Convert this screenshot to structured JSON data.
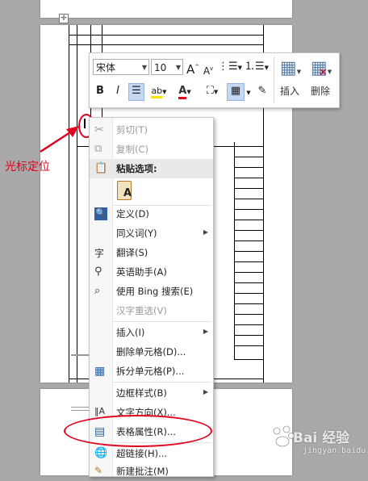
{
  "annotation": {
    "cursor_label": "光标定位"
  },
  "toolbar": {
    "font_name": "宋体",
    "font_size": "10",
    "insert_label": "插入",
    "delete_label": "删除",
    "bold": "B",
    "italic": "I",
    "grow_font": "A",
    "shrink_font": "A",
    "font_color": "A",
    "highlight": "ab"
  },
  "context_menu": {
    "items": [
      {
        "label": "剪切(T)",
        "disabled": true,
        "icon": "scissors-icon"
      },
      {
        "label": "复制(C)",
        "disabled": true,
        "icon": "copy-icon"
      },
      {
        "label": "粘贴选项:",
        "header": true,
        "icon": "clipboard-icon"
      },
      {
        "label": "A",
        "icon": "paste-keep-text-icon"
      },
      {
        "label": "定义(D)",
        "icon": "define-icon"
      },
      {
        "label": "同义词(Y)",
        "submenu": true
      },
      {
        "label": "翻译(S)",
        "icon": "translate-icon"
      },
      {
        "label": "英语助手(A)",
        "icon": "english-assistant-icon"
      },
      {
        "label": "使用 Bing 搜索(E)",
        "icon": "bing-search-icon"
      },
      {
        "label": "汉字重选(V)",
        "disabled": true
      },
      {
        "label": "插入(I)",
        "submenu": true
      },
      {
        "label": "删除单元格(D)..."
      },
      {
        "label": "拆分单元格(P)...",
        "icon": "split-cells-icon"
      },
      {
        "label": "边框样式(B)",
        "submenu": true
      },
      {
        "label": "文字方向(X)...",
        "icon": "text-direction-icon"
      },
      {
        "label": "表格属性(R)...",
        "icon": "table-properties-icon"
      },
      {
        "label": "超链接(H)...",
        "icon": "hyperlink-icon"
      },
      {
        "label": "新建批注(M)",
        "icon": "new-comment-icon"
      }
    ]
  },
  "watermark": {
    "text": "Bai 经验",
    "sub": "jingyan.baidu.com"
  },
  "colors": {
    "annotation_red": "#e0001b",
    "font_color_red": "#e0001b",
    "highlight_yellow": "#ffe100"
  }
}
